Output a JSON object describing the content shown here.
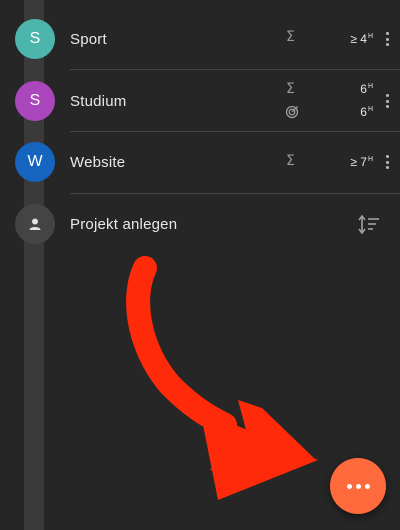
{
  "projects": [
    {
      "letter": "S",
      "name": "Sport",
      "color": "#4db6ac",
      "sigma_value": "≥ 4",
      "unit": "H"
    },
    {
      "letter": "S",
      "name": "Studium",
      "color": "#ab47bc",
      "sigma_value": "6",
      "target_value": "6",
      "unit": "H"
    },
    {
      "letter": "W",
      "name": "Website",
      "color": "#1565c0",
      "sigma_value": "≥ 7",
      "unit": "H"
    }
  ],
  "add_project": {
    "label": "Projekt anlegen"
  },
  "icons": {
    "sum": "sigma-icon",
    "target": "target-icon",
    "sort": "sort-icon",
    "menu": "more-vert-icon",
    "person": "person-icon",
    "fab": "more-horiz-icon",
    "annotation": "arrow-icon"
  },
  "colors": {
    "fab": "#ff6a3d",
    "arrow": "#ff2a0a"
  }
}
